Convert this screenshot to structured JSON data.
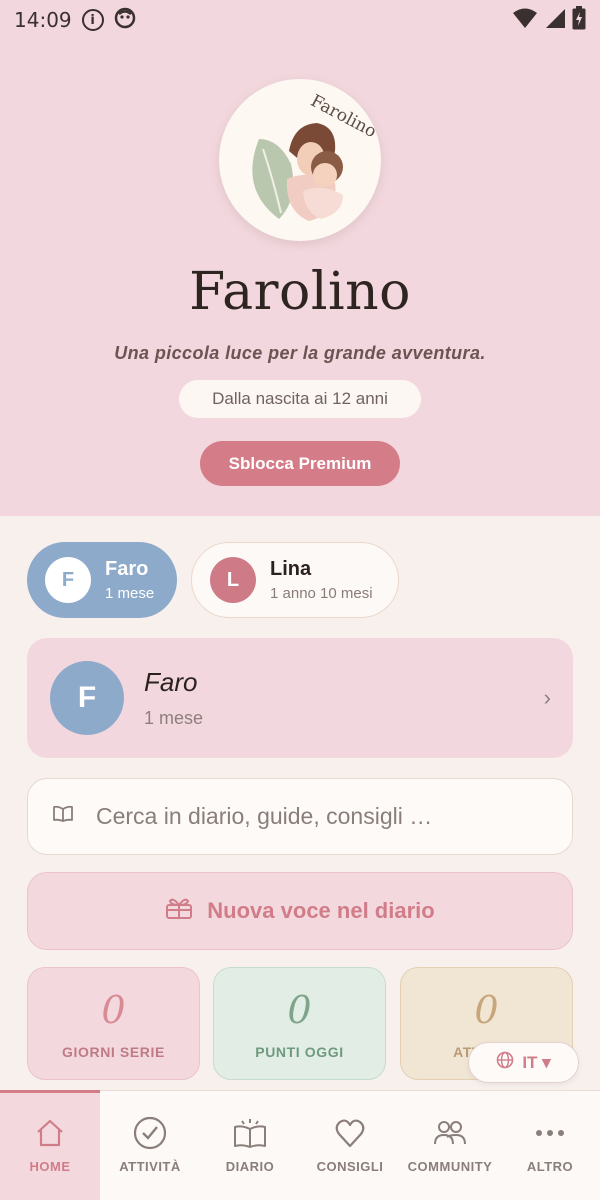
{
  "status_bar": {
    "time": "14:09",
    "info_glyph": "i",
    "battery_glyph": "⚡"
  },
  "hero": {
    "logo_text": "Farolino",
    "title": "Farolino",
    "tagline": "Una piccola luce per la grande avventura.",
    "age_range": "Dalla nascita ai 12 anni",
    "premium_label": "Sblocca Premium"
  },
  "children": [
    {
      "initial": "F",
      "name": "Faro",
      "age": "1 mese",
      "selected": true
    },
    {
      "initial": "L",
      "name": "Lina",
      "age": "1 anno 10 mesi",
      "selected": false
    }
  ],
  "profile": {
    "initial": "F",
    "name": "Faro",
    "age": "1 mese",
    "chevron": "›"
  },
  "search": {
    "placeholder": "Cerca in diario, guide, consigli …",
    "icon": "book-icon"
  },
  "new_entry": {
    "label": "Nuova voce nel diario",
    "icon": "gift-icon"
  },
  "stats": [
    {
      "value": "0",
      "label": "GIORNI SERIE"
    },
    {
      "value": "0",
      "label": "PUNTI OGGI"
    },
    {
      "value": "0",
      "label": "ATTIVITÀ"
    }
  ],
  "language": {
    "label": "IT ▾",
    "icon": "globe-icon"
  },
  "nav": [
    {
      "label": "HOME",
      "icon": "home-icon",
      "active": true
    },
    {
      "label": "ATTIVITÀ",
      "icon": "check-circle-icon",
      "active": false
    },
    {
      "label": "DIARIO",
      "icon": "open-book-icon",
      "active": false
    },
    {
      "label": "CONSIGLI",
      "icon": "heart-icon",
      "active": false
    },
    {
      "label": "COMMUNITY",
      "icon": "people-icon",
      "active": false
    },
    {
      "label": "ALTRO",
      "icon": "more-icon",
      "active": false
    }
  ],
  "colors": {
    "hero_bg": "#f2d8de",
    "accent": "#d47d88",
    "blue": "#8eaacb",
    "page_bg": "#f8f0ec"
  }
}
